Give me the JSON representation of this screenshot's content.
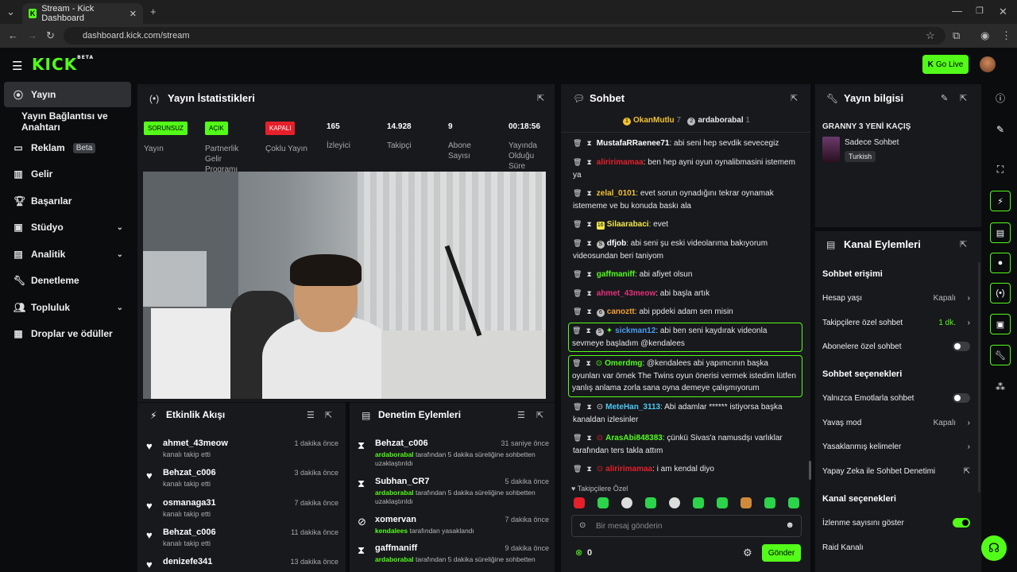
{
  "browser": {
    "tab_title": "Stream - Kick Dashboard",
    "url": "dashboard.kick.com/stream"
  },
  "header": {
    "logo": "KICK",
    "logo_sup": "BETA",
    "go_live": "Go Live"
  },
  "sidebar": {
    "items": [
      {
        "label": "Yayın",
        "icon": "broadcast-icon"
      },
      {
        "label": "Yayın Bağlantısı ve Anahtarı"
      },
      {
        "label": "Reklam",
        "badge": "Beta",
        "icon": "ad-icon"
      },
      {
        "label": "Gelir",
        "icon": "revenue-icon"
      },
      {
        "label": "Başarılar",
        "icon": "trophy-icon"
      },
      {
        "label": "Stüdyo",
        "icon": "studio-icon"
      },
      {
        "label": "Analitik",
        "icon": "analytics-icon"
      },
      {
        "label": "Denetleme",
        "icon": "wrench-icon"
      },
      {
        "label": "Topluluk",
        "icon": "community-icon"
      },
      {
        "label": "Droplar ve ödüller",
        "icon": "drops-icon"
      }
    ]
  },
  "stats": {
    "title": "Yayın İstatistikleri",
    "items": [
      {
        "badge": "SORUNSUZ",
        "label": "Yayın"
      },
      {
        "badge": "AÇIK",
        "label": "Partnerlik Gelir Programı"
      },
      {
        "badge": "KAPALI",
        "label": "Çoklu Yayın"
      },
      {
        "value": "165",
        "label": "İzleyici"
      },
      {
        "value": "14.928",
        "label": "Takipçi"
      },
      {
        "value": "9",
        "label": "Abone Sayısı"
      },
      {
        "value": "00:18:56",
        "label": "Yayında Olduğu Süre"
      }
    ],
    "colors": {
      "green": "#53fc18",
      "red": "#e5202b"
    }
  },
  "activity": {
    "title": "Etkinlik Akışı",
    "rows": [
      {
        "name": "ahmet_43meow",
        "sub": "kanalı takip etti",
        "time": "1 dakika önce"
      },
      {
        "name": "Behzat_c006",
        "sub": "kanalı takip etti",
        "time": "3 dakika önce"
      },
      {
        "name": "osmanaga31",
        "sub": "kanalı takip etti",
        "time": "7 dakika önce"
      },
      {
        "name": "Behzat_c006",
        "sub": "kanalı takip etti",
        "time": "11 dakika önce"
      },
      {
        "name": "denizefe341",
        "sub": "",
        "time": "13 dakika önce"
      }
    ]
  },
  "moderation": {
    "title": "Denetim Eylemleri",
    "rows": [
      {
        "name": "Behzat_c006",
        "by": "ardaborabal",
        "sub": " tarafından 5 dakika süreliğine sohbetten uzaklaştırıldı",
        "time": "31 saniye önce",
        "icon": "hourglass-icon"
      },
      {
        "name": "Subhan_CR7",
        "by": "ardaborabal",
        "sub": " tarafından 5 dakika süreliğine sohbetten uzaklaştırıldı",
        "time": "5 dakika önce",
        "icon": "hourglass-icon"
      },
      {
        "name": "xomervan",
        "by": "kendalees",
        "sub": " tarafından yasaklandı",
        "time": "7 dakika önce",
        "icon": "ban-icon"
      },
      {
        "name": "gaffmaniff",
        "by": "ardaborabal",
        "sub": " tarafından 5 dakika süreliğine sohbetten",
        "time": "9 dakika önce",
        "icon": "hourglass-icon"
      }
    ]
  },
  "chat": {
    "title": "Sohbet",
    "top_users": [
      {
        "rank": "1",
        "name": "OkanMutlu",
        "count": "7"
      },
      {
        "rank": "2",
        "name": "ardaborabal",
        "count": "1"
      }
    ],
    "messages": [
      {
        "user": "MustafaRRaenee71",
        "color": "#ffffff",
        "text": ": abi seni hep sevdik sevecegiz"
      },
      {
        "user": "aliririmamaa",
        "color": "#e5202b",
        "text": ": ben hep ayni oyun oynalibmasini istemem ya"
      },
      {
        "user": "zelal_0101",
        "color": "#f2c230",
        "text": ": evet sorun oynadığını tekrar oynamak istememe ve bu konuda baskı ala"
      },
      {
        "user": "Silaarabaci",
        "color": "#f2e84a",
        "text": ": evet"
      },
      {
        "user": "dfjob",
        "color": "#ffffff",
        "text": ": abi seni şu eski videolarıma bakıyorum videosundan beri taniyom"
      },
      {
        "user": "gaffmaniff",
        "color": "#53fc18",
        "text": ": abi afiyet olsun"
      },
      {
        "user": "ahmet_43meow",
        "color": "#e5307a",
        "text": ": abi başla artık"
      },
      {
        "user": "canoztt",
        "color": "#f2a030",
        "text": ": abi ppdeki adam sen misin"
      },
      {
        "user": "sickman12",
        "color": "#4a9ef2",
        "text": ": abi ben seni kaydırak videonla sevmeye başladım @kendalees"
      },
      {
        "user": "Omerdmg",
        "color": "#53fc18",
        "text": ": @kendalees abi yapımcının başka oyunları var örnek The Twins oyun önerisi vermek istedim lütfen yanlış anlama zorla sana oyna demeye çalışmıyorum"
      },
      {
        "user": "MeteHan_3113",
        "color": "#4ac8f2",
        "text": ": Abi adamlar ****** istiyorsa başka kanaldan izlesinler"
      },
      {
        "user": "ArasAbi848383",
        "color": "#53fc18",
        "text": ": çünkü Sivas'a namusdşı varlıklar tarafından ters takla attım"
      },
      {
        "user": "aliririmamaa",
        "color": "#e5202b",
        "text": ": i am kendal diyo"
      }
    ],
    "followers_only": "Takipçilere Özel",
    "input_placeholder": "Bir mesaj gönderin",
    "points": "0",
    "send": "Gönder"
  },
  "stream_info": {
    "title": "Yayın bilgisi",
    "stream_title": "GRANNY 3 YENİ KAÇIŞ",
    "category": "Sadece Sohbet",
    "tag": "Turkish"
  },
  "channel_actions": {
    "title": "Kanal Eylemleri",
    "chat_access": "Sohbet erişimi",
    "account_age": "Hesap yaşı",
    "account_age_val": "Kapalı",
    "followers_only": "Takipçilere özel sohbet",
    "followers_only_val": "1 dk.",
    "subs_only": "Abonelere özel sohbet",
    "chat_options": "Sohbet seçenekleri",
    "emote_only": "Yalnızca Emotlarla sohbet",
    "slow_mode": "Yavaş mod",
    "slow_mode_val": "Kapalı",
    "banned_words": "Yasaklanmış kelimeler",
    "ai_mod": "Yapay Zeka ile Sohbet Denetimi",
    "channel_options": "Kanal seçenekleri",
    "show_viewers": "İzlenme sayısını göster",
    "raid": "Raid Kanalı"
  }
}
